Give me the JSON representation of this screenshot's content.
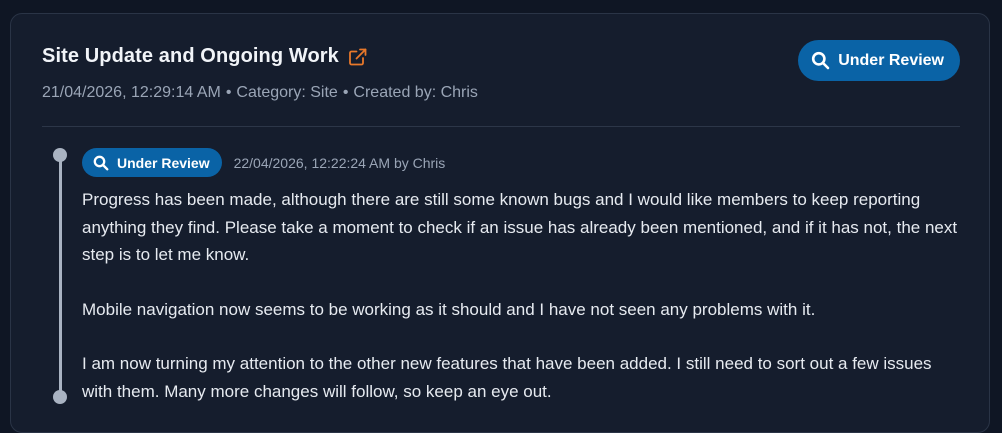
{
  "post": {
    "title": "Site Update and Ongoing Work",
    "meta": {
      "datetime": "21/04/2026, 12:29:14 AM",
      "separator": "•",
      "category": "Category: Site",
      "created_by": "Created by: Chris"
    },
    "status": "Under Review",
    "accent_color": "#0a63a6",
    "link_icon_color": "#e8782a"
  },
  "timeline": {
    "entries": [
      {
        "status": "Under Review",
        "meta": "22/04/2026, 12:22:24 AM by Chris",
        "paragraphs": [
          "Progress has been made, although there are still some known bugs and I would like members to keep reporting anything they find. Please take a moment to check if an issue has already been mentioned, and if it has not, the next step is to let me know.",
          "Mobile navigation now seems to be working as it should and I have not seen any problems with it.",
          "I am now turning my attention to the other new features that have been added. I still need to sort out a few issues with them. Many more changes will follow, so keep an eye out."
        ]
      }
    ]
  },
  "icons": {
    "title_link": "external-link-icon",
    "status": "search-icon"
  }
}
